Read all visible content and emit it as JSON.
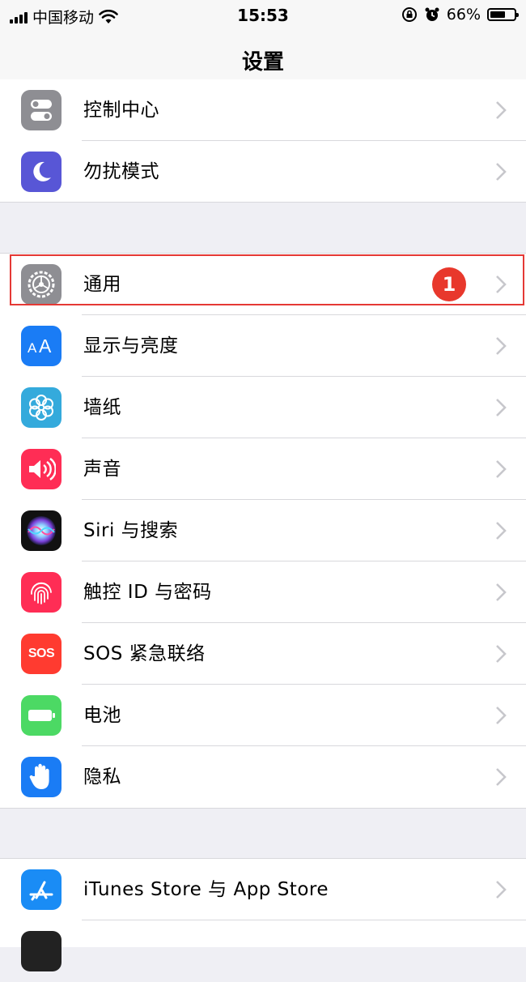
{
  "status": {
    "carrier": "中国移动",
    "time": "15:53",
    "battery_percent": "66%",
    "battery_level": 0.66
  },
  "nav": {
    "title": "设置"
  },
  "group1": [
    {
      "label": "控制中心",
      "icon": "control-center-icon",
      "color": "#8e8e93"
    },
    {
      "label": "勿扰模式",
      "icon": "moon-icon",
      "color": "#5856d6"
    }
  ],
  "group2": [
    {
      "label": "通用",
      "icon": "gear-icon",
      "color": "#8e8e93",
      "badge": "1"
    },
    {
      "label": "显示与亮度",
      "icon": "display-brightness-icon",
      "color": "#1a7cf5"
    },
    {
      "label": "墙纸",
      "icon": "wallpaper-flower-icon",
      "color": "#34aadc"
    },
    {
      "label": "声音",
      "icon": "speaker-icon",
      "color": "#ff2d55"
    },
    {
      "label": "Siri 与搜索",
      "icon": "siri-icon",
      "color": "#1c1c2e"
    },
    {
      "label": "触控 ID 与密码",
      "icon": "fingerprint-icon",
      "color": "#ff2d55"
    },
    {
      "label": "SOS 紧急联络",
      "icon": "sos-icon",
      "color": "#ff3b30",
      "icon_text": "SOS"
    },
    {
      "label": "电池",
      "icon": "battery-icon",
      "color": "#4cd964"
    },
    {
      "label": "隐私",
      "icon": "hand-privacy-icon",
      "color": "#1a7cf5"
    }
  ],
  "group3": [
    {
      "label": "iTunes Store 与 App Store",
      "icon": "app-store-icon",
      "color": "#1a8cf5"
    }
  ]
}
